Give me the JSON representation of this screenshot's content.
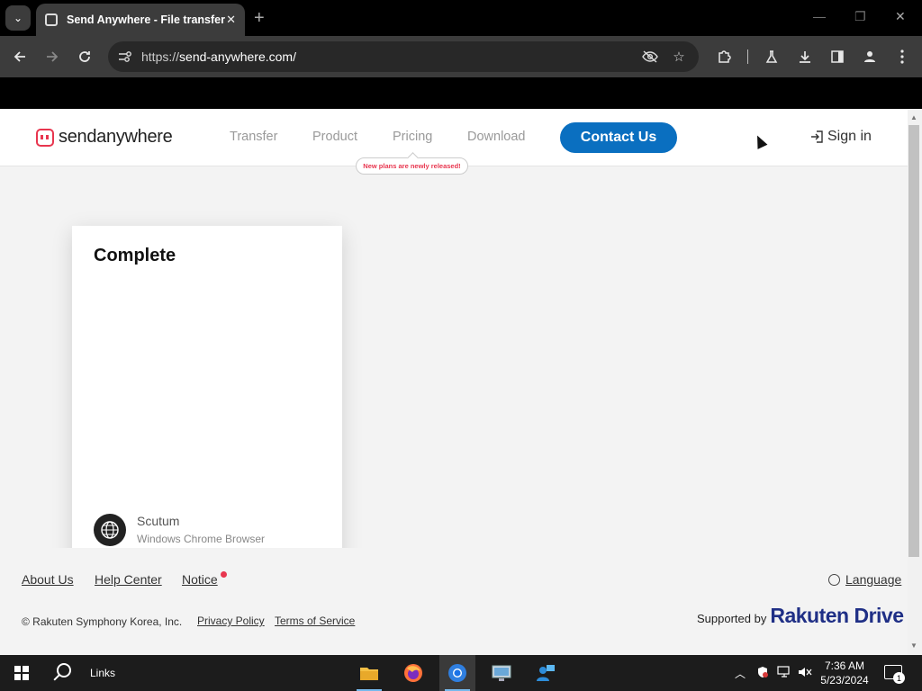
{
  "browser": {
    "tab_title": "Send Anywhere - File transfer",
    "url_prefix": "https://",
    "url_host": "send-anywhere.com/",
    "window_controls": [
      "—",
      "❐",
      "✕"
    ]
  },
  "site": {
    "logo_text": "sendanywhere",
    "nav": [
      "Transfer",
      "Product",
      "Pricing",
      "Download"
    ],
    "contact_label": "Contact Us",
    "pricing_badge": "New plans are newly released!",
    "signin_label": "Sign in"
  },
  "card": {
    "heading": "Complete",
    "device_name": "Scutum",
    "device_sub": "Windows Chrome Browser"
  },
  "footer": {
    "links": [
      "About Us",
      "Help Center",
      "Notice"
    ],
    "language_label": "Language",
    "copyright": "© Rakuten Symphony Korea, Inc.",
    "legal_links": [
      "Privacy Policy",
      "Terms of Service"
    ],
    "supported_prefix": "Supported by",
    "supported_brand": "Rakuten Drive"
  },
  "taskbar": {
    "links_label": "Links",
    "time": "7:36 AM",
    "date": "5/23/2024",
    "notification_count": "1"
  },
  "colors": {
    "brand_red": "#e8364f",
    "contact_blue": "#0a6fc0",
    "rakuten_navy": "#1f2f86"
  },
  "icons": {
    "browser_toolbar": [
      "back-icon",
      "forward-icon",
      "reload-icon",
      "site-info-icon",
      "eye-slash-icon",
      "star-icon",
      "extensions-icon",
      "flask-icon",
      "download-icon",
      "sidepanel-icon",
      "profile-icon",
      "menu-dots-icon"
    ],
    "taskbar_apps": [
      "file-explorer-icon",
      "firefox-icon",
      "chrome-icon",
      "remote-desktop-icon",
      "people-icon"
    ]
  }
}
